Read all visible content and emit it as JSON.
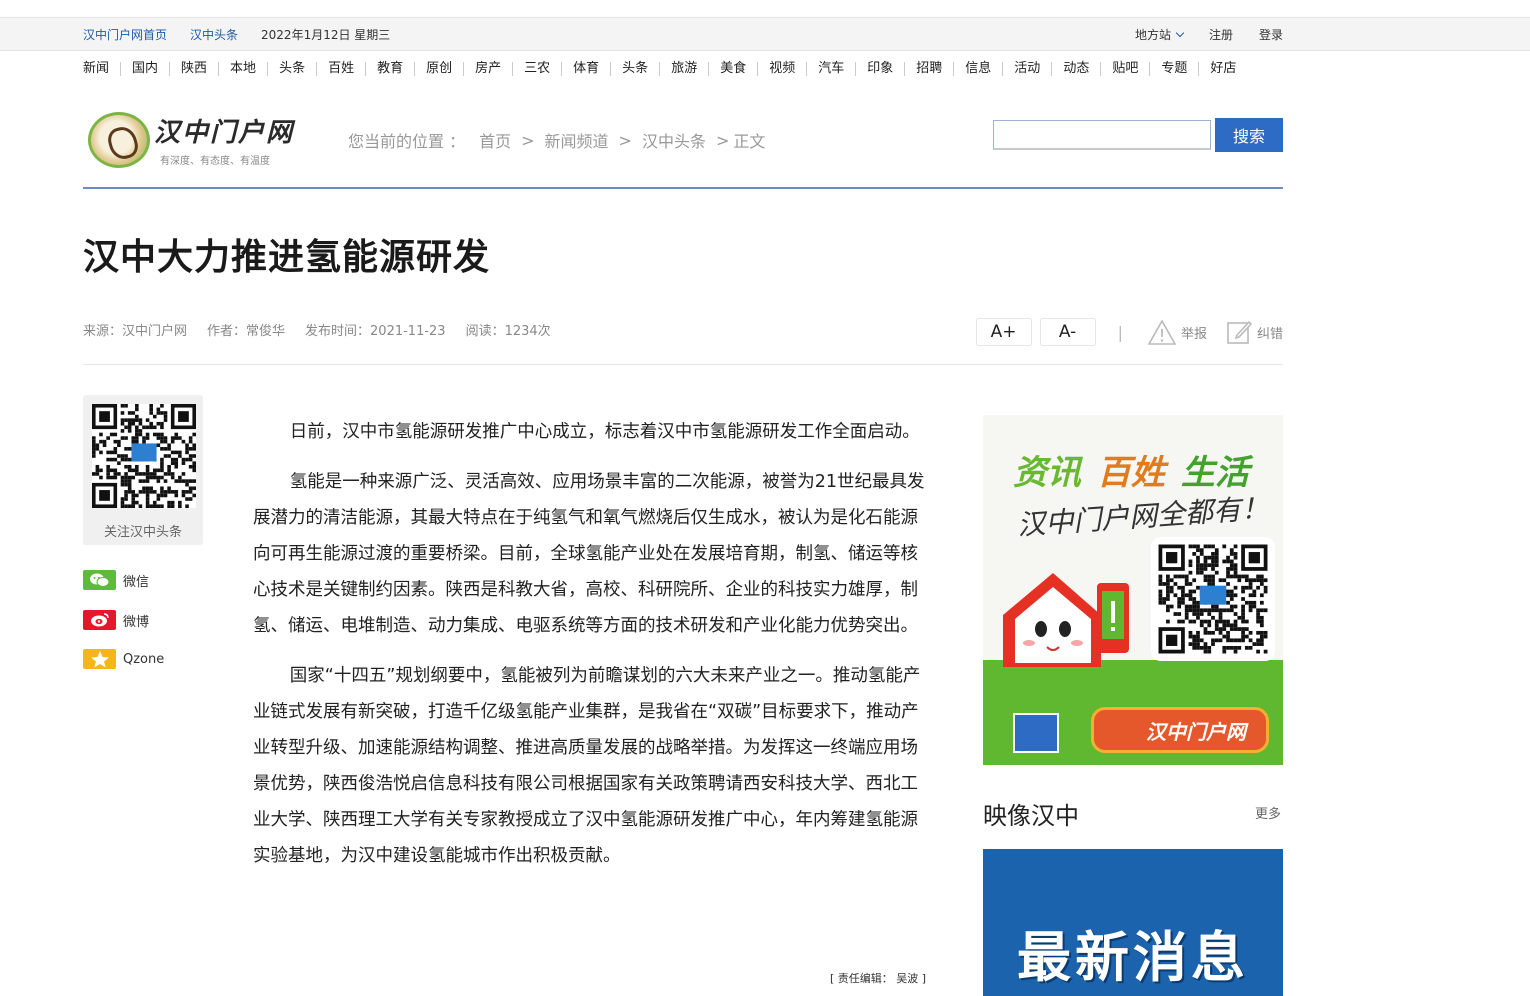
{
  "topbar": {
    "home_link": "汉中门户网首页",
    "headline_link": "汉中头条",
    "date": "2022年1月12日 星期三",
    "local_site": "地方站",
    "register": "注册",
    "login": "登录"
  },
  "nav": [
    "新闻",
    "国内",
    "陕西",
    "本地",
    "头条",
    "百姓",
    "教育",
    "原创",
    "房产",
    "三农",
    "体育",
    "头条",
    "旅游",
    "美食",
    "视频",
    "汽车",
    "印象",
    "招聘",
    "信息",
    "活动",
    "动态",
    "贴吧",
    "专题",
    "好店"
  ],
  "logo": {
    "name": "汉中门户网",
    "slogan": "有深度、有态度、有温度"
  },
  "breadcrumb": {
    "prefix": "您当前的位置 ：",
    "items": [
      "首页",
      "新闻频道",
      "汉中头条",
      "正文"
    ],
    "separator": ">"
  },
  "search": {
    "placeholder": "",
    "button": "搜索"
  },
  "article": {
    "title": "汉中大力推进氢能源研发",
    "source": "来源：汉中门户网",
    "author": "作者：常俊华",
    "published": "发布时间：2021-11-23",
    "reads": "阅读：1234次",
    "paragraphs": [
      "日前，汉中市氢能源研发推广中心成立，标志着汉中市氢能源研发工作全面启动。",
      "氢能是一种来源广泛、灵活高效、应用场景丰富的二次能源，被誉为21世纪最具发展潜力的清洁能源，其最大特点在于纯氢气和氧气燃烧后仅生成水，被认为是化石能源向可再生能源过渡的重要桥梁。目前，全球氢能产业处在发展培育期，制氢、储运等核心技术是关键制约因素。陕西是科教大省，高校、科研院所、企业的科技实力雄厚，制氢、储运、电堆制造、动力集成、电驱系统等方面的技术研发和产业化能力优势突出。",
      "国家“十四五”规划纲要中，氢能被列为前瞻谋划的六大未来产业之一。推动氢能产业链式发展有新突破，打造千亿级氢能产业集群，是我省在“双碳”目标要求下，推动产业转型升级、加速能源结构调整、推进高质量发展的战略举措。为发挥这一终端应用场景优势，陕西俊浩悦启信息科技有限公司根据国家有关政策聘请西安科技大学、西北工业大学、陕西理工大学有关专家教授成立了汉中氢能源研发推广中心，年内筹建氢能源实验基地，为汉中建设氢能城市作出积极贡献。"
    ],
    "editor": "[ 责任编辑： 吴波 ]"
  },
  "tools": {
    "font_up": "A+",
    "font_down": "A-",
    "divider": "|",
    "report": "举报",
    "correct": "纠错"
  },
  "share": {
    "qr_caption": "关注汉中头条",
    "wechat": "微信",
    "weibo": "微博",
    "qzone": "Qzone",
    "colors": {
      "wechat": "#5cbb3a",
      "weibo": "#e6162d",
      "qzone": "#f5b61a"
    }
  },
  "sidebar": {
    "ad1": {
      "line1": [
        "资讯",
        "百姓",
        "生活"
      ],
      "line2": "汉中门户网全都有！",
      "logo_text": "汉中门户网"
    },
    "video_title": "映像汉中",
    "more": "更多",
    "ad2_text": "最新消息"
  }
}
